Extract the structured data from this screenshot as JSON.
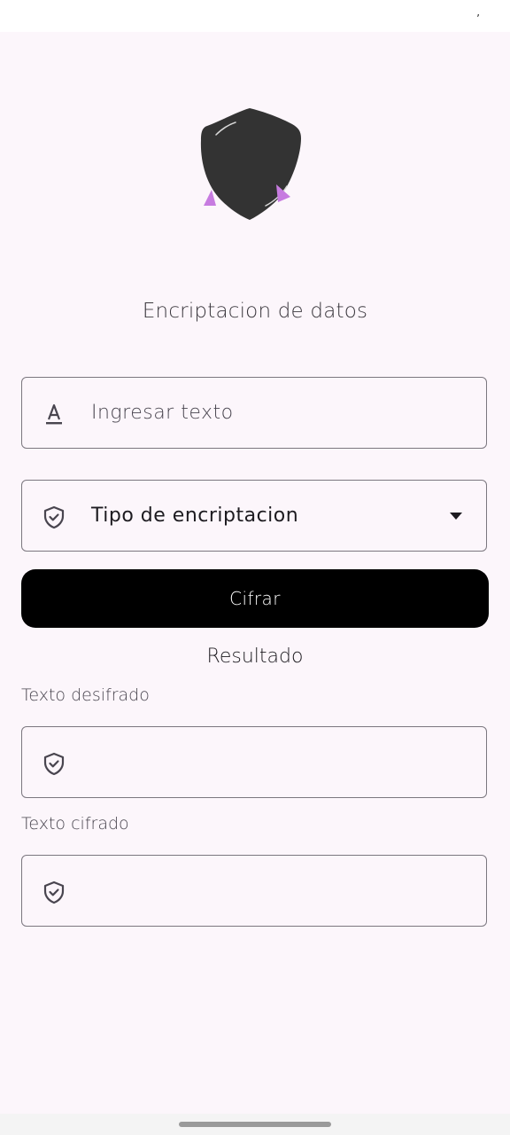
{
  "status_bar": {
    "mark": "ʼ"
  },
  "header": {
    "title": "Encriptacion de datos"
  },
  "input": {
    "placeholder": "Ingresar texto",
    "icon": "text-format-icon"
  },
  "select": {
    "placeholder": "Tipo de encriptacion",
    "icon": "shield-check-icon",
    "arrow_icon": "dropdown-arrow-icon"
  },
  "actions": {
    "encrypt_label": "Cifrar"
  },
  "result": {
    "title": "Resultado",
    "decrypted": {
      "label": "Texto desifrado",
      "value": "",
      "icon": "shield-check-icon"
    },
    "encrypted": {
      "label": "Texto cifrado",
      "value": "",
      "icon": "shield-check-icon"
    }
  },
  "colors": {
    "background": "#fcf6fb",
    "button": "#000000",
    "accent": "#c77be0",
    "logo": "#333333"
  }
}
